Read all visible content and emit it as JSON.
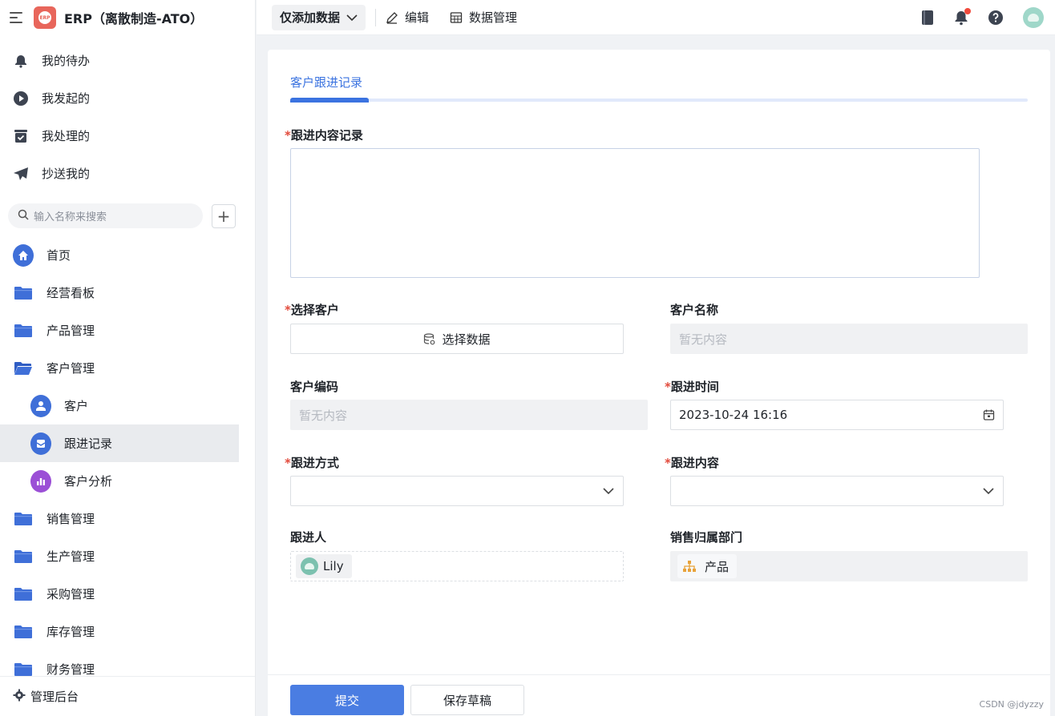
{
  "app": {
    "title": "ERP（离散制造-ATO）",
    "logo_text": "ERP"
  },
  "quick_links": [
    {
      "label": "我的待办",
      "icon": "bell-icon"
    },
    {
      "label": "我发起的",
      "icon": "play-circle-icon"
    },
    {
      "label": "我处理的",
      "icon": "inbox-check-icon"
    },
    {
      "label": "抄送我的",
      "icon": "paper-plane-icon"
    }
  ],
  "search": {
    "placeholder": "输入名称来搜索"
  },
  "nav": [
    {
      "label": "首页",
      "icon": "home-icon"
    },
    {
      "label": "经营看板",
      "icon": "folder-icon"
    },
    {
      "label": "产品管理",
      "icon": "folder-icon"
    },
    {
      "label": "客户管理",
      "icon": "folder-open-icon"
    },
    {
      "label": "客户",
      "icon": "customer-icon"
    },
    {
      "label": "跟进记录",
      "icon": "followup-icon"
    },
    {
      "label": "客户分析",
      "icon": "bar-chart-icon"
    },
    {
      "label": "销售管理",
      "icon": "folder-icon"
    },
    {
      "label": "生产管理",
      "icon": "folder-icon"
    },
    {
      "label": "采购管理",
      "icon": "folder-icon"
    },
    {
      "label": "库存管理",
      "icon": "folder-icon"
    },
    {
      "label": "财务管理",
      "icon": "folder-icon"
    }
  ],
  "sidebar_footer": {
    "label": "管理后台",
    "icon": "gear-icon"
  },
  "toolbar": {
    "view_select": "仅添加数据",
    "edit": "编辑",
    "data_manage": "数据管理"
  },
  "form": {
    "tab": "客户跟进记录",
    "fields": {
      "followup_record": {
        "label": "跟进内容记录",
        "required": "*",
        "value": ""
      },
      "select_customer": {
        "label": "选择客户",
        "required": "*",
        "button": "选择数据"
      },
      "customer_name": {
        "label": "客户名称",
        "value": "暂无内容"
      },
      "customer_code": {
        "label": "客户编码",
        "value": "暂无内容"
      },
      "followup_time": {
        "label": "跟进时间",
        "required": "*",
        "value": "2023-10-24 16:16"
      },
      "followup_method": {
        "label": "跟进方式",
        "required": "*",
        "value": ""
      },
      "followup_content": {
        "label": "跟进内容",
        "required": "*",
        "value": ""
      },
      "followup_person": {
        "label": "跟进人",
        "value": "Lily"
      },
      "sales_dept": {
        "label": "销售归属部门",
        "value": "产品"
      }
    }
  },
  "actions": {
    "submit": "提交",
    "save_draft": "保存草稿"
  },
  "watermark": "CSDN @jdyzzy",
  "colors": {
    "accent": "#4a7de2",
    "folder": "#3f6fd8",
    "required": "#e24a3b"
  }
}
